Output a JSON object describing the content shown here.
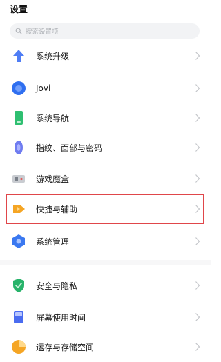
{
  "header": {
    "title": "设置"
  },
  "search": {
    "placeholder": "搜索设置项"
  },
  "settings": {
    "items": [
      {
        "label": "系统升级",
        "icon": "system-update-icon",
        "color": "#4f7df5"
      },
      {
        "label": "Jovi",
        "icon": "jovi-icon",
        "color": "#2f6ff0"
      },
      {
        "label": "系统导航",
        "icon": "navigation-icon",
        "color": "#2fbf71"
      },
      {
        "label": "指纹、面部与密码",
        "icon": "fingerprint-icon",
        "color": "#6f7cf0"
      },
      {
        "label": "游戏魔盒",
        "icon": "game-box-icon",
        "color": "#9aa0a8"
      },
      {
        "label": "快捷与辅助",
        "icon": "shortcut-icon",
        "color": "#f5a524"
      },
      {
        "label": "系统管理",
        "icon": "system-manage-icon",
        "color": "#3a78f0"
      },
      {
        "label": "安全与隐私",
        "icon": "security-icon",
        "color": "#27b36a"
      },
      {
        "label": "屏幕使用时间",
        "icon": "screen-time-icon",
        "color": "#4a6cf0"
      },
      {
        "label": "运存与存储空间",
        "icon": "storage-icon",
        "color": "#f5a524"
      }
    ]
  }
}
